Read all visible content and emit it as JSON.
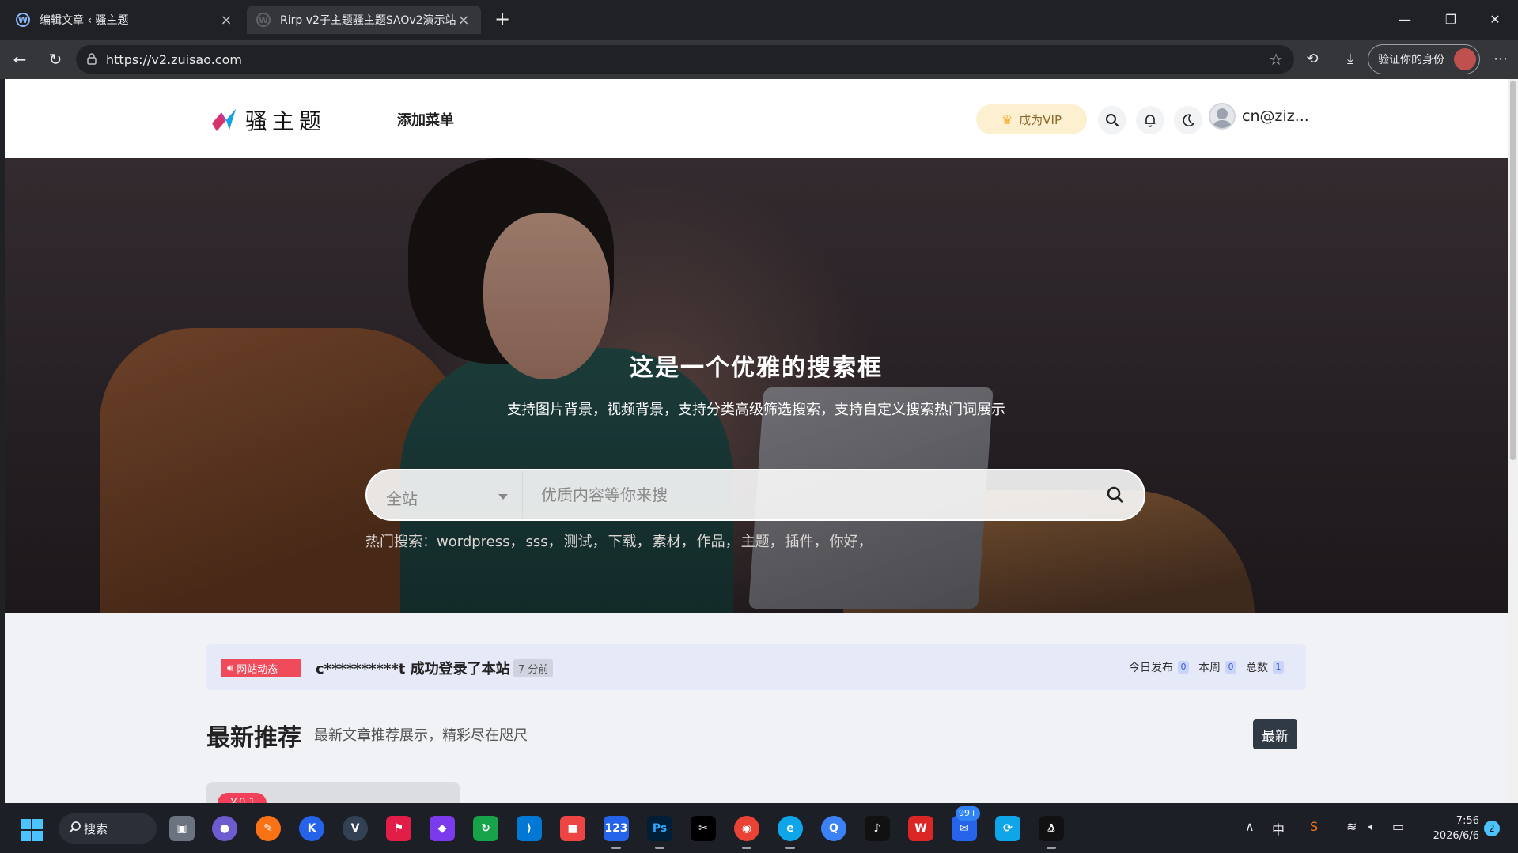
{
  "browser": {
    "tabs": [
      {
        "title": "编辑文章 ‹ 骚主题",
        "active": false
      },
      {
        "title": "Rirp v2子主题骚主题SAOv2演示站",
        "active": true
      }
    ],
    "url": "https://v2.zuisao.com",
    "profile_label": "验证你的身份"
  },
  "site": {
    "logo_text": "骚主题",
    "menu_link": "添加菜单",
    "vip_label": "成为VIP",
    "username": "cn@ziz...",
    "hero": {
      "title": "这是一个优雅的搜索框",
      "subtitle": "支持图片背景，视频背景，支持分类高级筛选搜索，支持自定义搜索热门词展示",
      "scope": "全站",
      "placeholder": "优质内容等你来搜",
      "hot_label": "热门搜索：",
      "hot_keywords": [
        "wordpress，",
        "sss，",
        "测试，",
        "下载，",
        "素材，",
        "作品，",
        "主题，",
        "插件，",
        "你好，"
      ]
    },
    "ticker": {
      "badge": "网站动态",
      "message": "c**********t 成功登录了本站",
      "ago": "7 分前",
      "stats": [
        {
          "label": "今日发布",
          "value": "0"
        },
        {
          "label": "本周",
          "value": "0"
        },
        {
          "label": "总数",
          "value": "1"
        }
      ]
    },
    "section": {
      "title": "最新推荐",
      "subtitle": "最新文章推荐展示，精彩尽在咫尺",
      "button": "最新"
    },
    "card": {
      "price": "￥0.1"
    }
  },
  "taskbar": {
    "search_label": "搜索",
    "ime": "中",
    "time": "7:56",
    "date": "2026/6/6",
    "notifications": "2",
    "mail_badge": "99+"
  },
  "colors": {
    "accent_red": "#f04b5a",
    "vip_bg": "#fdf0d0",
    "ticker_bg": "#e6e9f8",
    "dark_button": "#2f3a44"
  }
}
